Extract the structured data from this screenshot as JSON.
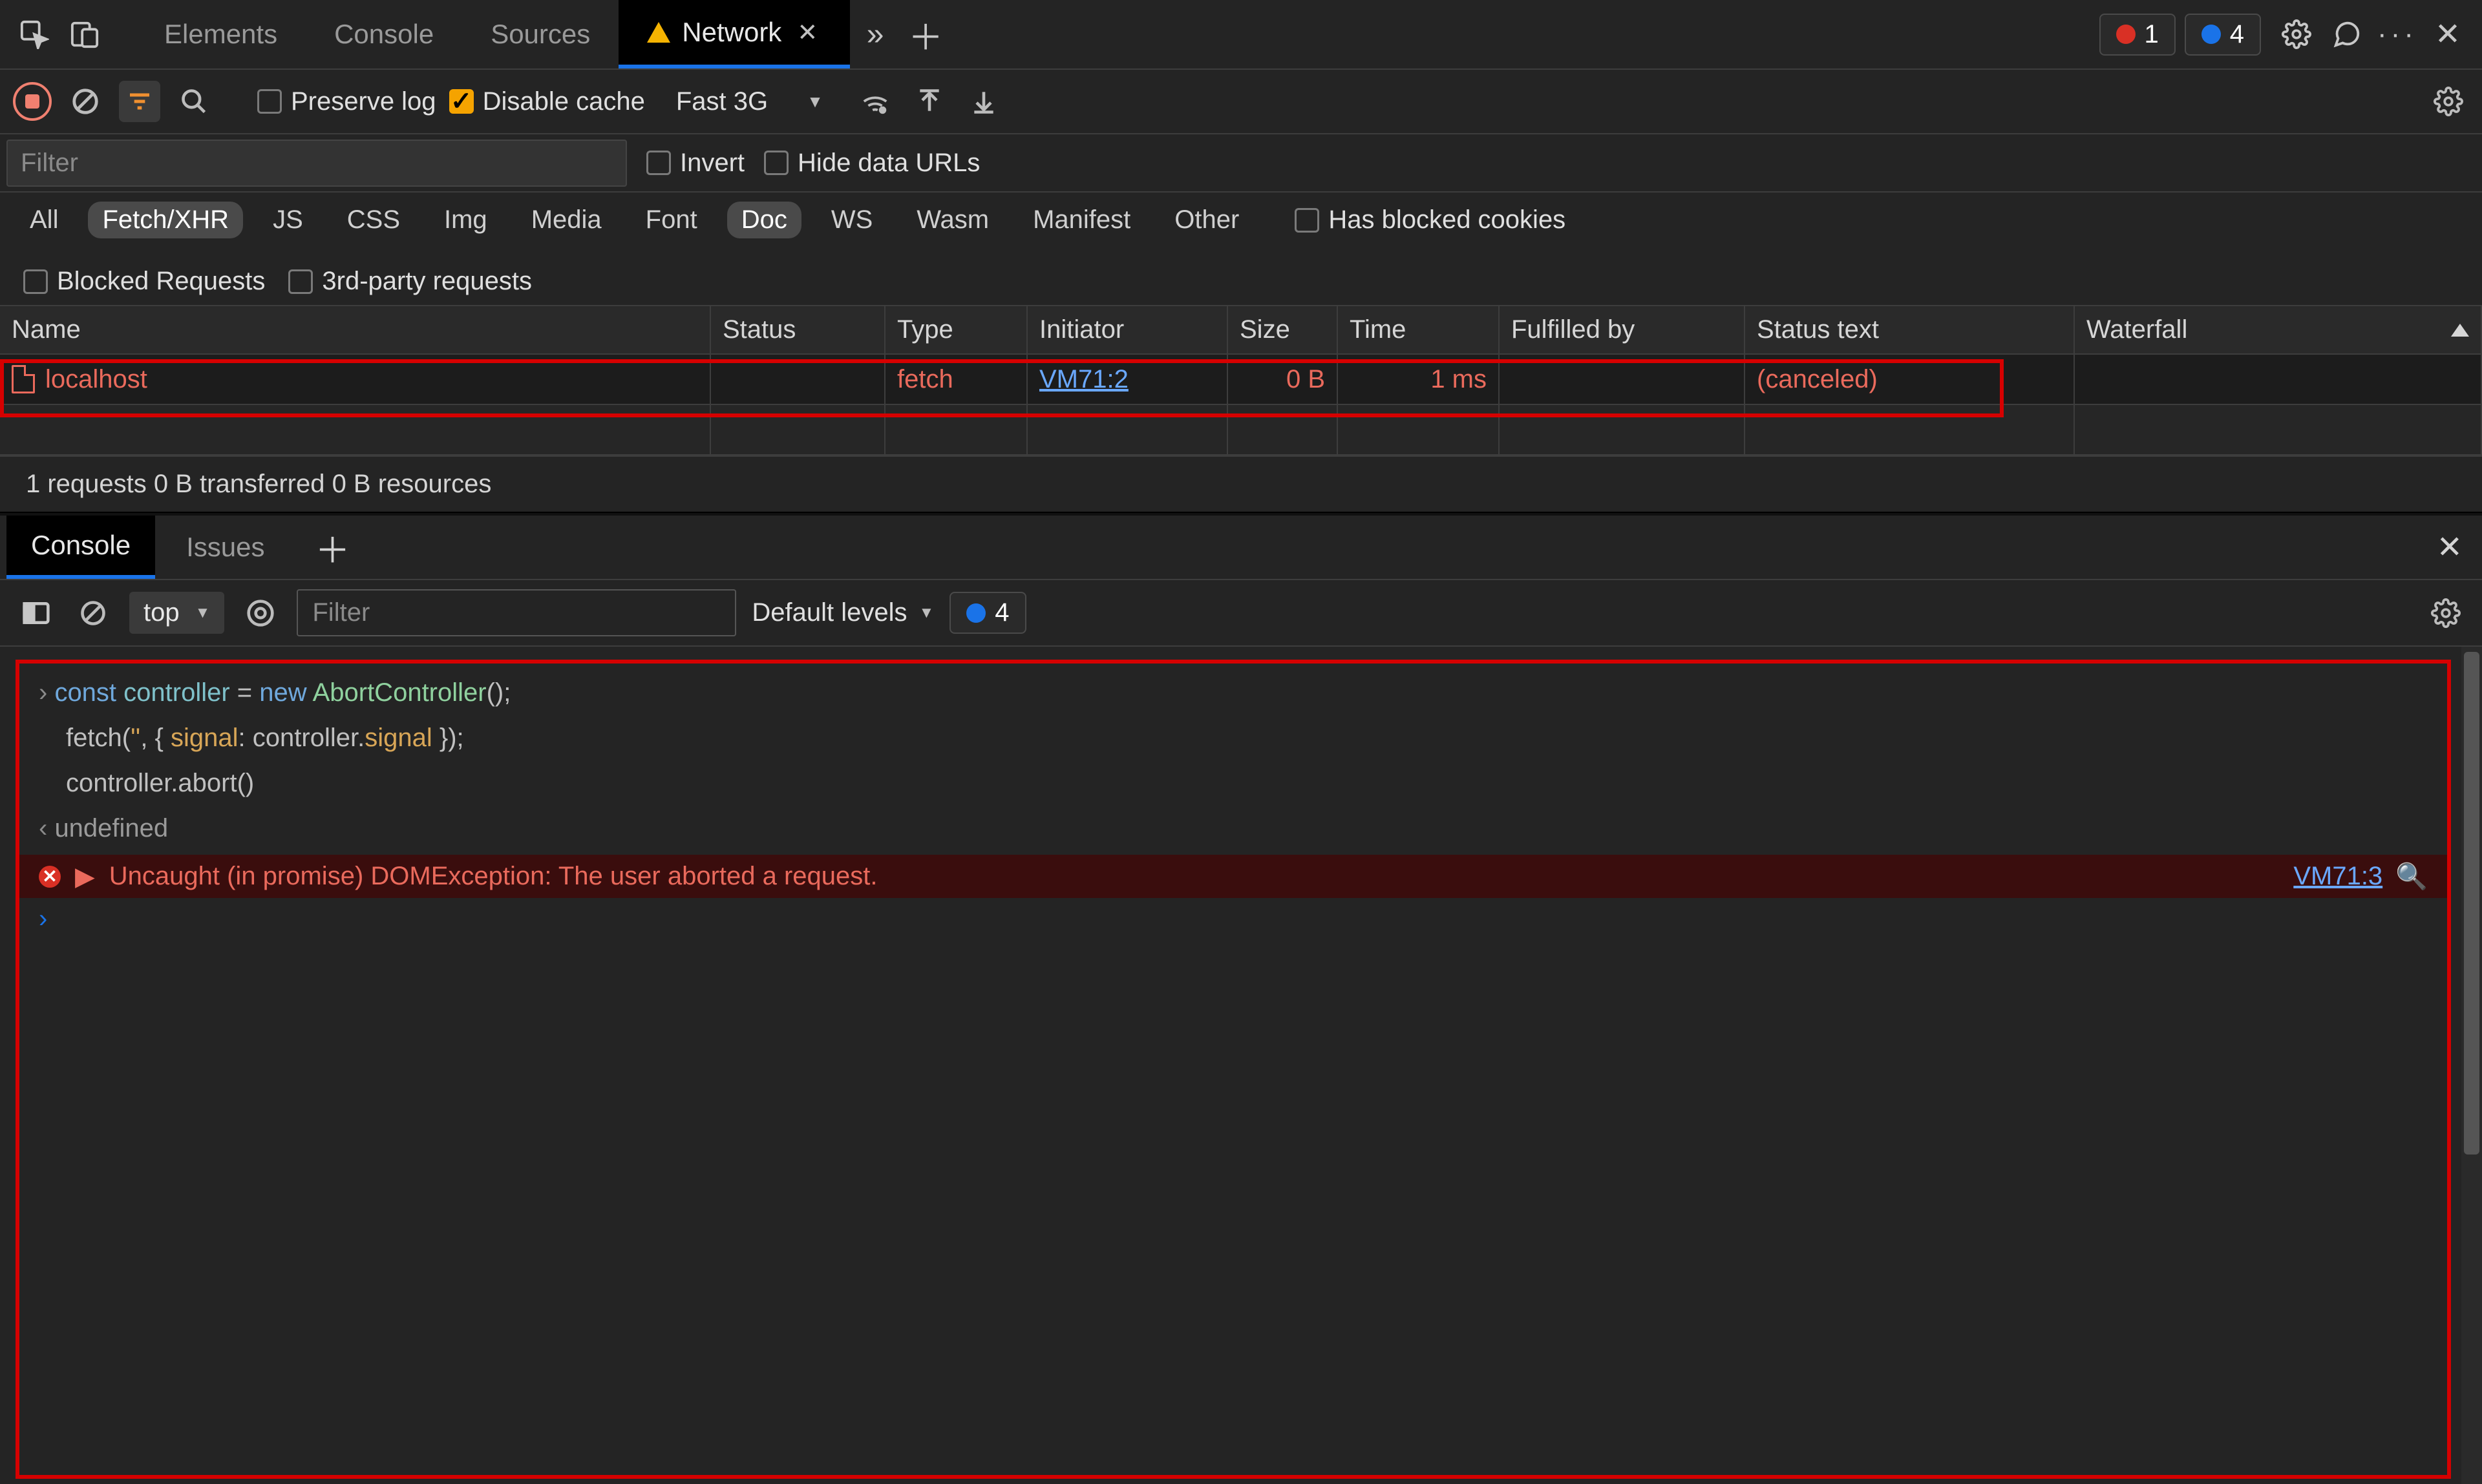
{
  "topbar": {
    "tabs": {
      "elements": "Elements",
      "console": "Console",
      "sources": "Sources",
      "network": "Network"
    },
    "active_tab": "network",
    "errors_count": "1",
    "issues_count": "4"
  },
  "toolbar": {
    "preserve_log_label": "Preserve log",
    "disable_cache_label": "Disable cache",
    "disable_cache_checked": true,
    "throttling_value": "Fast 3G"
  },
  "filterbar": {
    "filter_placeholder": "Filter",
    "invert_label": "Invert",
    "hide_data_urls_label": "Hide data URLs"
  },
  "type_filters": {
    "items": [
      "All",
      "Fetch/XHR",
      "JS",
      "CSS",
      "Img",
      "Media",
      "Font",
      "Doc",
      "WS",
      "Wasm",
      "Manifest",
      "Other"
    ],
    "active": [
      "Fetch/XHR",
      "Doc"
    ],
    "has_blocked_cookies_label": "Has blocked cookies",
    "blocked_requests_label": "Blocked Requests",
    "third_party_label": "3rd-party requests"
  },
  "table": {
    "columns": [
      "Name",
      "Status",
      "Type",
      "Initiator",
      "Size",
      "Time",
      "Fulfilled by",
      "Status text",
      "Waterfall"
    ],
    "rows": [
      {
        "name": "localhost",
        "status": "",
        "type": "fetch",
        "initiator": "VM71:2",
        "size": "0 B",
        "time": "1 ms",
        "fulfilled_by": "",
        "status_text": "(canceled)"
      }
    ]
  },
  "statusbar": {
    "text": "1 requests   0 B transferred   0 B resources"
  },
  "drawer": {
    "tabs": {
      "console": "Console",
      "issues": "Issues"
    },
    "active_tab": "console"
  },
  "console_toolbar": {
    "context_value": "top",
    "filter_placeholder": "Filter",
    "levels_label": "Default levels",
    "issues_count": "4"
  },
  "console": {
    "in_l1_kw_const": "const",
    "in_l1_var": " controller ",
    "in_l1_eq": "= ",
    "in_l1_kw_new": "new",
    "in_l1_cls": " AbortController",
    "in_l1_tail": "();",
    "in_l2_fn": "fetch",
    "in_l2_p1": "(",
    "in_l2_str": "''",
    "in_l2_p2": ", { ",
    "in_l2_sig": "signal",
    "in_l2_p3": ": controller.",
    "in_l2_sig2": "signal",
    "in_l2_p4": " });",
    "in_l3": "controller.abort()",
    "out_val": "undefined",
    "err_msg": "Uncaught (in promise) DOMException: The user aborted a request.",
    "err_link": "VM71:3"
  }
}
